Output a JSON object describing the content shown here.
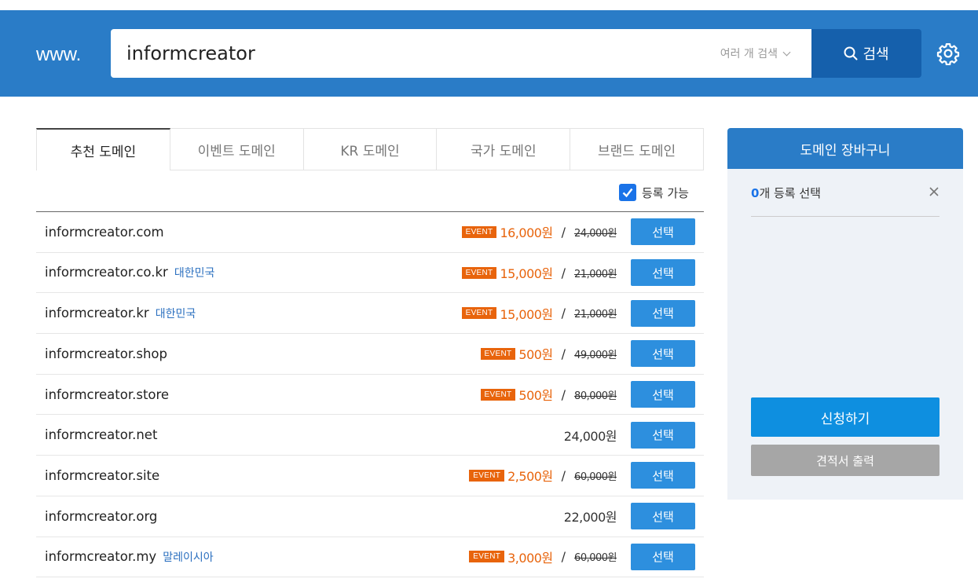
{
  "header": {
    "prefix": "www.",
    "search_value": "informcreator",
    "multi_search_label": "여러 개 검색",
    "search_button": "검색"
  },
  "tabs": [
    "추천 도메인",
    "이벤트 도메인",
    "KR 도메인",
    "국가 도메인",
    "브랜드 도메인"
  ],
  "filter": {
    "available_label": "등록 가능",
    "available_checked": true
  },
  "colors": {
    "brand": "#2a7cc7",
    "event": "#e8640c",
    "select": "#2d8fde"
  },
  "domains": [
    {
      "name": "informcreator.com",
      "country": "",
      "event": true,
      "event_label": "EVENT",
      "price": "16,000원",
      "slash": "/",
      "original": "24,000원",
      "select": "선택"
    },
    {
      "name": "informcreator.co.kr",
      "country": "대한민국",
      "event": true,
      "event_label": "EVENT",
      "price": "15,000원",
      "slash": "/",
      "original": "21,000원",
      "select": "선택"
    },
    {
      "name": "informcreator.kr",
      "country": "대한민국",
      "event": true,
      "event_label": "EVENT",
      "price": "15,000원",
      "slash": "/",
      "original": "21,000원",
      "select": "선택"
    },
    {
      "name": "informcreator.shop",
      "country": "",
      "event": true,
      "event_label": "EVENT",
      "price": "500원",
      "slash": "/",
      "original": "49,000원",
      "select": "선택"
    },
    {
      "name": "informcreator.store",
      "country": "",
      "event": true,
      "event_label": "EVENT",
      "price": "500원",
      "slash": "/",
      "original": "80,000원",
      "select": "선택"
    },
    {
      "name": "informcreator.net",
      "country": "",
      "event": false,
      "price": "24,000원",
      "select": "선택"
    },
    {
      "name": "informcreator.site",
      "country": "",
      "event": true,
      "event_label": "EVENT",
      "price": "2,500원",
      "slash": "/",
      "original": "60,000원",
      "select": "선택"
    },
    {
      "name": "informcreator.org",
      "country": "",
      "event": false,
      "price": "22,000원",
      "select": "선택"
    },
    {
      "name": "informcreator.my",
      "country": "말레이시아",
      "event": true,
      "event_label": "EVENT",
      "price": "3,000원",
      "slash": "/",
      "original": "60,000원",
      "select": "선택"
    }
  ],
  "cart": {
    "title": "도메인 장바구니",
    "count": "0",
    "count_suffix": "개 등록 선택",
    "apply_button": "신청하기",
    "quote_button": "견적서 출력"
  }
}
